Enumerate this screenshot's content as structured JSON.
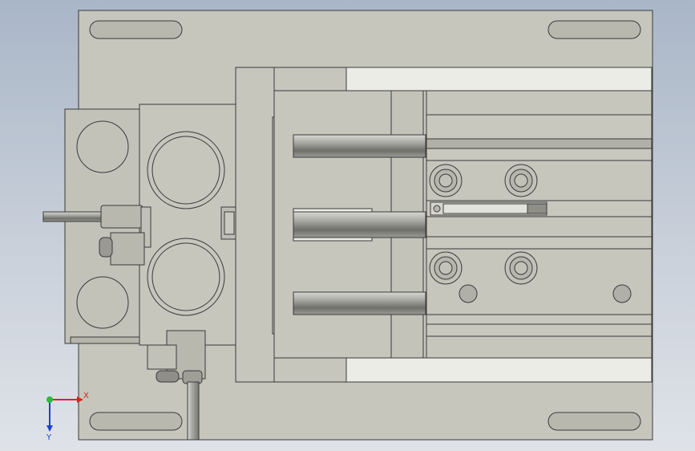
{
  "triad": {
    "x_label": "X",
    "y_label": "Y",
    "x_color": "#e02020",
    "y_color": "#2040d0",
    "origin_color": "#20c040"
  },
  "colors": {
    "plate": "#c6c6bd",
    "edge": "#3a3a3a",
    "rail_light": "#ecece6",
    "rod": "#8d8d88"
  }
}
